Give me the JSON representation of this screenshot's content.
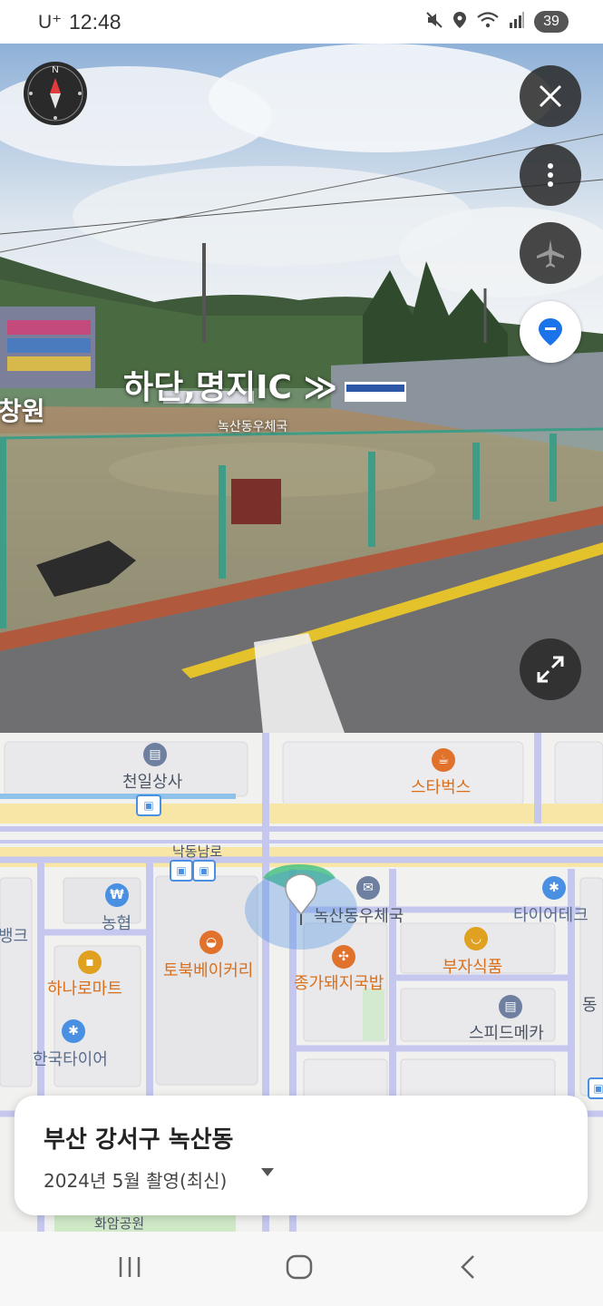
{
  "status_bar": {
    "carrier": "U⁺",
    "time": "12:48",
    "battery": "39"
  },
  "street_view": {
    "sign_text": "하단,명지IC ≫",
    "building_label": "녹산동우체국",
    "left_edge_text": "창원",
    "icons": [
      "compass-icon",
      "close-icon",
      "more-vertical-icon",
      "airplane-icon",
      "location-pin-icon",
      "expand-icon"
    ]
  },
  "map": {
    "pois": {
      "cheonil": "천일상사",
      "starbucks": "스타벅스",
      "nakdong": "낙동남로",
      "nonghyup": "농협",
      "bank": "뱅크",
      "hanaro": "하나로마트",
      "tobuk": "토북베이커리",
      "postoffice": "녹산동우체국",
      "tire": "타이어테크",
      "jongga": "종가돼지국밥",
      "buja": "부자식품",
      "speedmate": "스피드메카",
      "hankook": "한국타이어",
      "dong": "동",
      "hwaam": "화암공원"
    }
  },
  "location_card": {
    "title": "부산 강서구 녹산동",
    "date": "2024년 5월 촬영(최신)"
  },
  "nav_bar": {
    "icons": [
      "recent-apps-icon",
      "home-icon",
      "back-icon"
    ]
  },
  "colors": {
    "road": "#c5c7ef",
    "yellow_road": "#f8e6a6",
    "accent_blue": "#1a73e8",
    "orange": "#e0722c"
  }
}
